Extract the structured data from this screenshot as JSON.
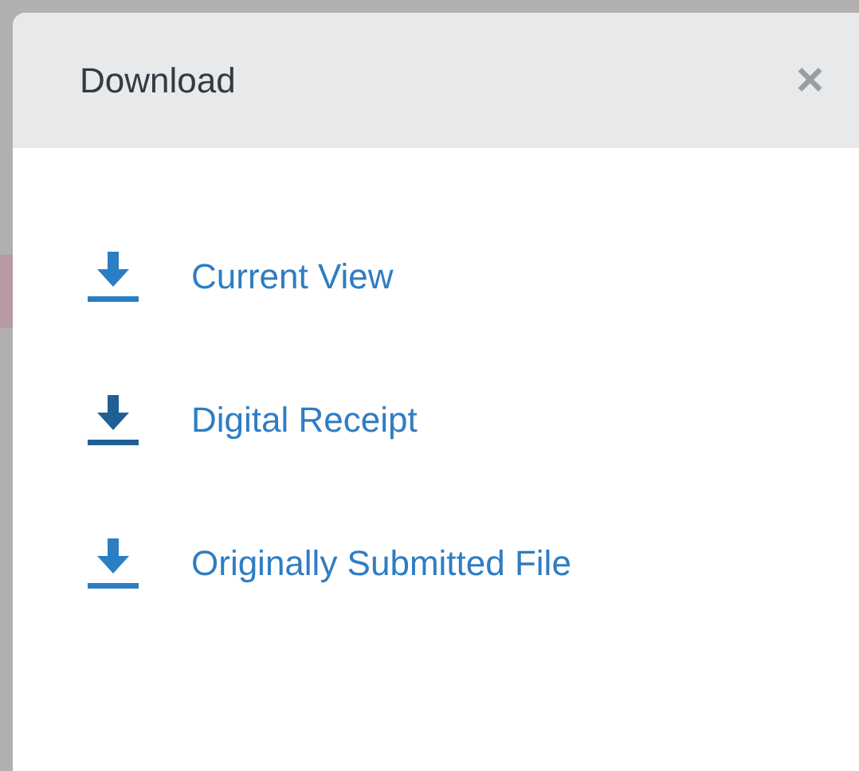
{
  "dialog": {
    "title": "Download",
    "close": "×",
    "items": [
      {
        "label": "Current View",
        "hovered": false
      },
      {
        "label": "Digital Receipt",
        "hovered": true
      },
      {
        "label": "Originally Submitted File",
        "hovered": false
      }
    ]
  }
}
